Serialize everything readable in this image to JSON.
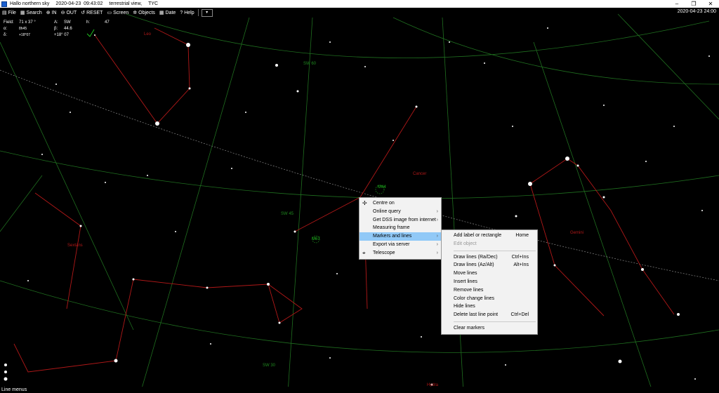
{
  "window": {
    "app_name": "Hallo northern sky",
    "date": "2020-04-23",
    "time": "09:43:02",
    "view_mode": "terrestrial view,",
    "catalog": "TYC",
    "minimize": "–",
    "restore": "❐",
    "close": "✕"
  },
  "toolbar": {
    "file": "File",
    "search": "Search",
    "zoom_in": "IN",
    "zoom_out": "OUT",
    "reset": "RESET",
    "screen": "Screen",
    "objects": "Objects",
    "date": "Date",
    "help": "Help",
    "dropdown": "▾",
    "datetime": "2020-04-23  24:00"
  },
  "info": {
    "field_label": "Field:",
    "field_value": "71 x  37 °",
    "a_label": "A:",
    "a_value": "SW",
    "h_label": "h:",
    "h_value": "47",
    "alpha_label": "α:",
    "alpha_small": "8h45",
    "beta_label": "β:",
    "beta_value": "44.6",
    "delta_label": "δ:",
    "delta_small": "+18°07",
    "delta_value": "+18° 07"
  },
  "sky_labels": {
    "leo": "Leo",
    "cancer": "Cancer",
    "gemini": "Gemini",
    "sextans": "Sextans",
    "hydra": "Hydra",
    "sw_top": "SW 60",
    "sw_mid": "SW 45",
    "sw_bottom": "SW 30",
    "m44": "M44",
    "m67": "M67"
  },
  "context_menu": {
    "items": [
      {
        "label": "Centre on",
        "arrow": ""
      },
      {
        "label": "Online query",
        "arrow": "›"
      },
      {
        "label": "Get DSS image from internet",
        "arrow": "›"
      },
      {
        "label": "Measuring frame",
        "arrow": ""
      },
      {
        "label": "Markers and lines",
        "arrow": "›"
      },
      {
        "label": "Export via server",
        "arrow": "›"
      },
      {
        "label": "Telescope",
        "arrow": "›"
      }
    ]
  },
  "submenu": {
    "add_label": "Add label or rectangle",
    "add_label_sc": "Home",
    "edit_object": "Edit object",
    "draw_radec": "Draw lines (Ra/Dec)",
    "draw_radec_sc": "Ctrl+Ins",
    "draw_azalt": "Draw lines (Az/Alt)",
    "draw_azalt_sc": "Alt+Ins",
    "move_lines": "Move lines",
    "insert_lines": "Insert lines",
    "remove_lines": "Remove lines",
    "color_change": "Color change lines",
    "hide_lines": "Hide lines",
    "delete_last": "Delete last line point",
    "delete_last_sc": "Ctrl+Del",
    "clear_markers": "Clear markers"
  },
  "status": {
    "text": "Line menus"
  },
  "colors": {
    "grid": "#1f7a1f",
    "constellation": "#b01818",
    "menu_highlight": "#91c9f7"
  }
}
